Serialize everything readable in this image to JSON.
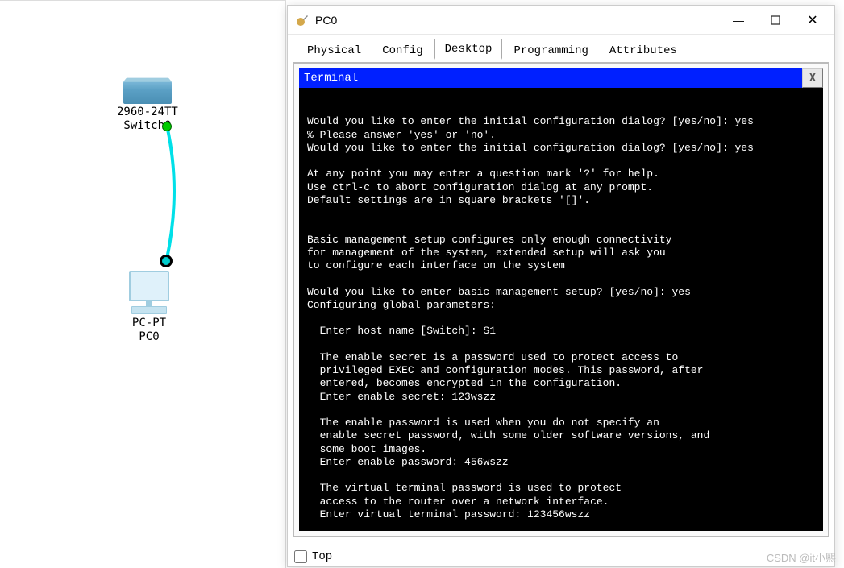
{
  "topology": {
    "switch": {
      "model": "2960-24TT",
      "name": "Switch0"
    },
    "pc": {
      "model": "PC-PT",
      "name": "PC0"
    }
  },
  "window": {
    "title": "PC0",
    "tabs": [
      {
        "label": "Physical"
      },
      {
        "label": "Config"
      },
      {
        "label": "Desktop"
      },
      {
        "label": "Programming"
      },
      {
        "label": "Attributes"
      }
    ],
    "activeTabIndex": 2,
    "terminal": {
      "header": "Terminal",
      "close": "X",
      "body": "\nWould you like to enter the initial configuration dialog? [yes/no]: yes\n% Please answer 'yes' or 'no'.\nWould you like to enter the initial configuration dialog? [yes/no]: yes\n\nAt any point you may enter a question mark '?' for help.\nUse ctrl-c to abort configuration dialog at any prompt.\nDefault settings are in square brackets '[]'.\n\n\nBasic management setup configures only enough connectivity\nfor management of the system, extended setup will ask you\nto configure each interface on the system\n\nWould you like to enter basic management setup? [yes/no]: yes\nConfiguring global parameters:\n\n  Enter host name [Switch]: S1\n\n  The enable secret is a password used to protect access to\n  privileged EXEC and configuration modes. This password, after\n  entered, becomes encrypted in the configuration.\n  Enter enable secret: 123wszz\n\n  The enable password is used when you do not specify an\n  enable secret password, with some older software versions, and\n  some boot images.\n  Enter enable password: 456wszz\n\n  The virtual terminal password is used to protect\n  access to the router over a network interface.\n  Enter virtual terminal password: 123456wszz"
    },
    "top_checkbox_label": "Top"
  },
  "watermark": "CSDN @it小熙"
}
